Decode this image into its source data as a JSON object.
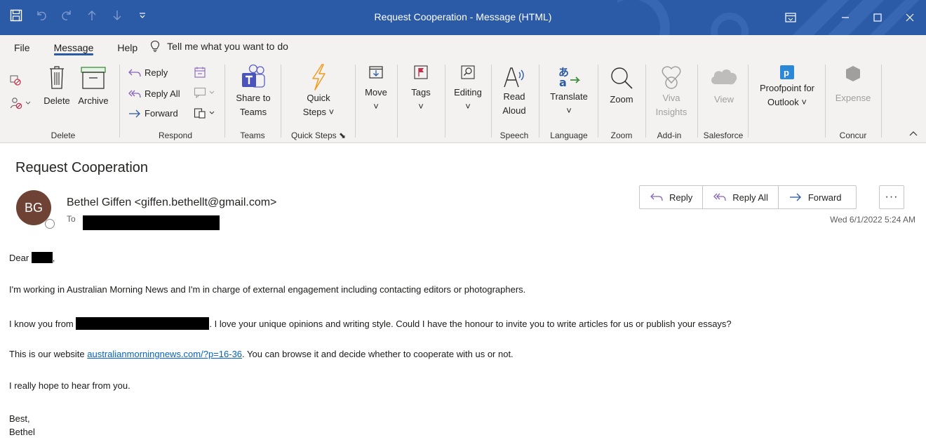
{
  "window": {
    "title": "Request Cooperation  -  Message (HTML)",
    "qat_icons": [
      "save-icon",
      "undo-icon",
      "redo-icon",
      "up-arrow-icon",
      "down-arrow-icon",
      "customize-icon"
    ]
  },
  "tabs": [
    {
      "label": "File"
    },
    {
      "label": "Message",
      "active": true
    },
    {
      "label": "Help"
    }
  ],
  "tell_me": "Tell me what you want to do",
  "ribbon": {
    "delete_group": {
      "label": "Delete",
      "delete": "Delete",
      "archive": "Archive"
    },
    "respond_group": {
      "label": "Respond",
      "reply": "Reply",
      "reply_all": "Reply All",
      "forward": "Forward"
    },
    "teams_group": {
      "label": "Teams",
      "share_line1": "Share to",
      "share_line2": "Teams"
    },
    "quicksteps_group": {
      "label": "Quick Steps",
      "line1": "Quick",
      "line2": "Steps"
    },
    "move": "Move",
    "tags": "Tags",
    "editing": "Editing",
    "speech_group": {
      "label": "Speech",
      "line1": "Read",
      "line2": "Aloud"
    },
    "language_group": {
      "label": "Language",
      "translate": "Translate"
    },
    "zoom_group": {
      "label": "Zoom",
      "zoom": "Zoom"
    },
    "addin_group": {
      "label": "Add-in",
      "line1": "Viva",
      "line2": "Insights"
    },
    "salesforce_group": {
      "label": "Salesforce",
      "view": "View"
    },
    "proofpoint": {
      "line1": "Proofpoint for",
      "line2": "Outlook"
    },
    "concur_group": {
      "label": "Concur",
      "expense": "Expense"
    }
  },
  "message": {
    "subject": "Request Cooperation",
    "avatar_initials": "BG",
    "sender": "Bethel Giffen <giffen.bethellt@gmail.com>",
    "to_label": "To",
    "date": "Wed 6/1/2022 5:24 AM",
    "actions": {
      "reply": "Reply",
      "reply_all": "Reply All",
      "forward": "Forward",
      "more": "···"
    }
  },
  "body": {
    "greeting_prefix": "Dear ",
    "greeting_suffix": ",",
    "para1": "I'm working in Australian Morning News and I'm in charge of external engagement including contacting editors or photographers.",
    "para2_prefix": "I know you from ",
    "para2_suffix": ". I love your unique opinions and writing style. Could I have the honour to invite you to write articles for us or publish your essays?",
    "para3_prefix": "This is our website ",
    "para3_link": "australianmorningnews.com/?p=16-36",
    "para3_suffix": ". You can browse it and decide whether to cooperate with us or not.",
    "para4": "I really hope to hear from you.",
    "signoff": "Best,",
    "signature": "Bethel"
  }
}
